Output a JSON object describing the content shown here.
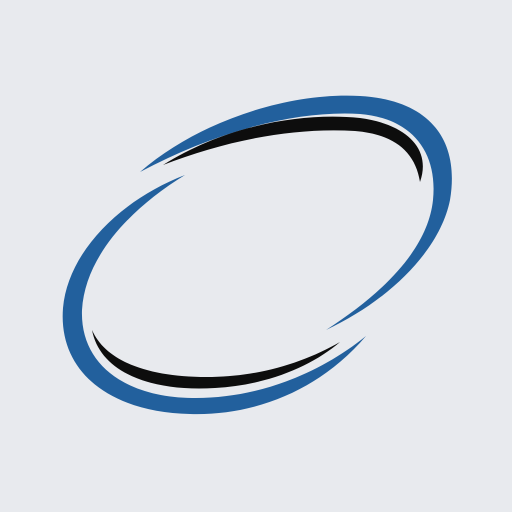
{
  "logo": {
    "icon": "swoosh-ellipse-logo-icon",
    "colors": {
      "background": "#e8eaee",
      "outer_swoosh": "#22609d",
      "inner_swoosh": "#0d0d0d"
    }
  }
}
